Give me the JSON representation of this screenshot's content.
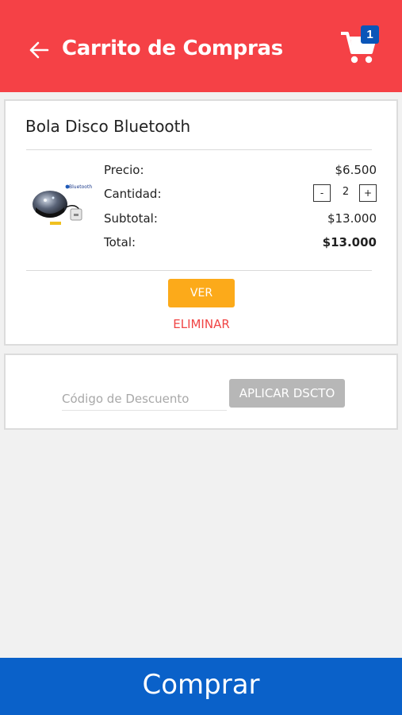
{
  "header": {
    "title": "Carrito de Compras",
    "back_icon": "arrow-left-icon",
    "cart_icon": "cart-icon",
    "cart_count": "1",
    "background": "#f54146"
  },
  "item": {
    "name": "Bola Disco Bluetooth",
    "image_icon": "disco-ball-product-image",
    "image_brand_text": "Bluetooth",
    "price_label": "Precio:",
    "price_value": "$6.500",
    "quantity_label": "Cantidad:",
    "quantity_value": "2",
    "quantity_minus": "-",
    "quantity_plus": "+",
    "subtotal_label": "Subtotal:",
    "subtotal_value": "$13.000",
    "total_label": "Total:",
    "total_value": "$13.000",
    "view_label": "VER",
    "delete_label": "ELIMINAR"
  },
  "discount": {
    "placeholder": "Código de Descuento",
    "apply_label": "APLICAR DSCTO"
  },
  "footer": {
    "buy_label": "Comprar",
    "background": "#0a61c9"
  }
}
